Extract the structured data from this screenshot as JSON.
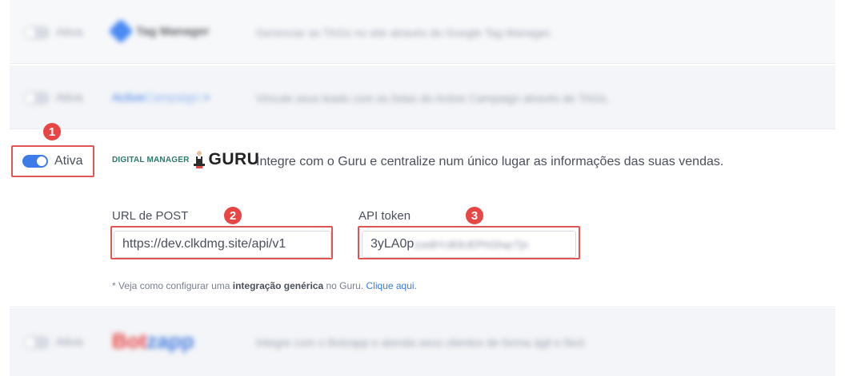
{
  "integrations": [
    {
      "toggle_label": "Ativa",
      "enabled": false,
      "logo_text": "Tag Manager",
      "icon": "tag-manager-diamond-icon",
      "description": "Gerenciar as TAGs no site através do Google Tag Manager."
    },
    {
      "toggle_label": "Ativa",
      "enabled": false,
      "logo_text_main": "Active",
      "logo_text_light": "Campaign",
      "logo_arrow": ">",
      "description": "Vincule seus leads com as listas do Active Campaign através de TAGs."
    },
    {
      "toggle_label": "Ativa",
      "enabled": true,
      "logo_text_small": "DIGITAL MANAGER",
      "logo_text_big": "GURU",
      "description": "Integre com o Guru e centralize num único lugar as informações das suas vendas.",
      "url_label": "URL de POST",
      "url_value": "https://dev.clkdmg.site/api/v1",
      "token_label": "API token",
      "token_visible": "3yLA0p",
      "token_masked": "zzeBYcB3UEPhGhqcTjn",
      "note_prefix": "* Veja como configurar uma ",
      "note_bold": "integração genérica",
      "note_middle": " no Guru. ",
      "note_link": "Clique aqui",
      "note_suffix": "."
    },
    {
      "toggle_label": "Ativa",
      "enabled": false,
      "logo_text_red": "Bot",
      "logo_text_blue": "zapp",
      "description": "Integre com o Botzapp e atenda seus clientes de forma ágil e fácil."
    }
  ],
  "annotations": {
    "badge_1": "1",
    "badge_2": "2",
    "badge_3": "3",
    "highlight_color": "#e05555",
    "badge_color": "#e84545"
  },
  "colors": {
    "accent": "#3d7be8",
    "text": "#4a4f5c",
    "muted": "#9aa0ad"
  }
}
